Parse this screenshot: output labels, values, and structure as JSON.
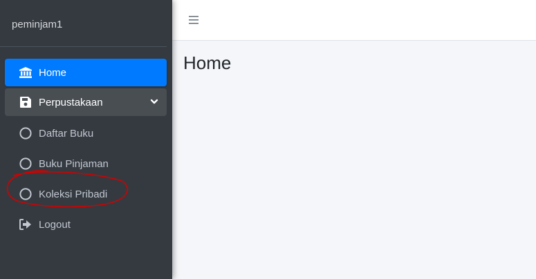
{
  "brand": {
    "username": "peminjam1"
  },
  "sidebar": {
    "items": [
      {
        "label": "Home",
        "icon": "bank-icon"
      },
      {
        "label": "Perpustakaan",
        "icon": "floppy-icon"
      },
      {
        "label": "Daftar Buku",
        "icon": "circle-icon"
      },
      {
        "label": "Buku Pinjaman",
        "icon": "circle-icon"
      },
      {
        "label": "Koleksi Pribadi",
        "icon": "circle-icon"
      },
      {
        "label": "Logout",
        "icon": "sign-out-icon"
      }
    ]
  },
  "main": {
    "title": "Home"
  },
  "colors": {
    "sidebar_bg": "#343a40",
    "active": "#007bff",
    "open": "#494e53",
    "annotation": "#d40000"
  }
}
